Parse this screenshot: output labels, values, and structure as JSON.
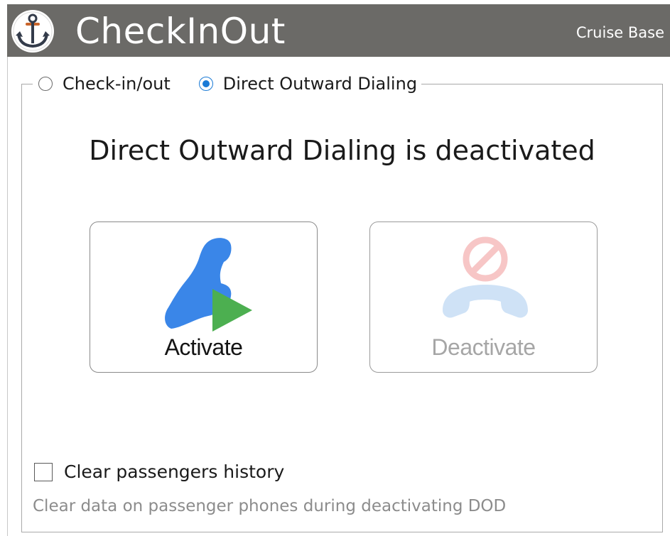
{
  "header": {
    "title": "CheckInOut",
    "subtitle": "Cruise Base",
    "background": "#6b6a67",
    "icon": "anchor-icon"
  },
  "mode": {
    "options": [
      {
        "label": "Check-in/out",
        "checked": false
      },
      {
        "label": "Direct Outward Dialing",
        "checked": true
      }
    ],
    "accent": "#1a7ad6"
  },
  "status_text": "Direct Outward Dialing is deactivated",
  "actions": {
    "activate": {
      "label": "Activate",
      "enabled": true,
      "icon": "phone-play-icon",
      "phone_color": "#3a86e8",
      "play_color": "#4caf50"
    },
    "deactivate": {
      "label": "Deactivate",
      "enabled": false,
      "icon": "phone-hangup-blocked-icon",
      "phone_color": "#cfe2f6",
      "block_color": "#f7c6c6"
    }
  },
  "options": {
    "clear_history_label": "Clear passengers history",
    "clear_history_checked": false,
    "hint": "Clear data on passenger phones during deactivating DOD"
  }
}
